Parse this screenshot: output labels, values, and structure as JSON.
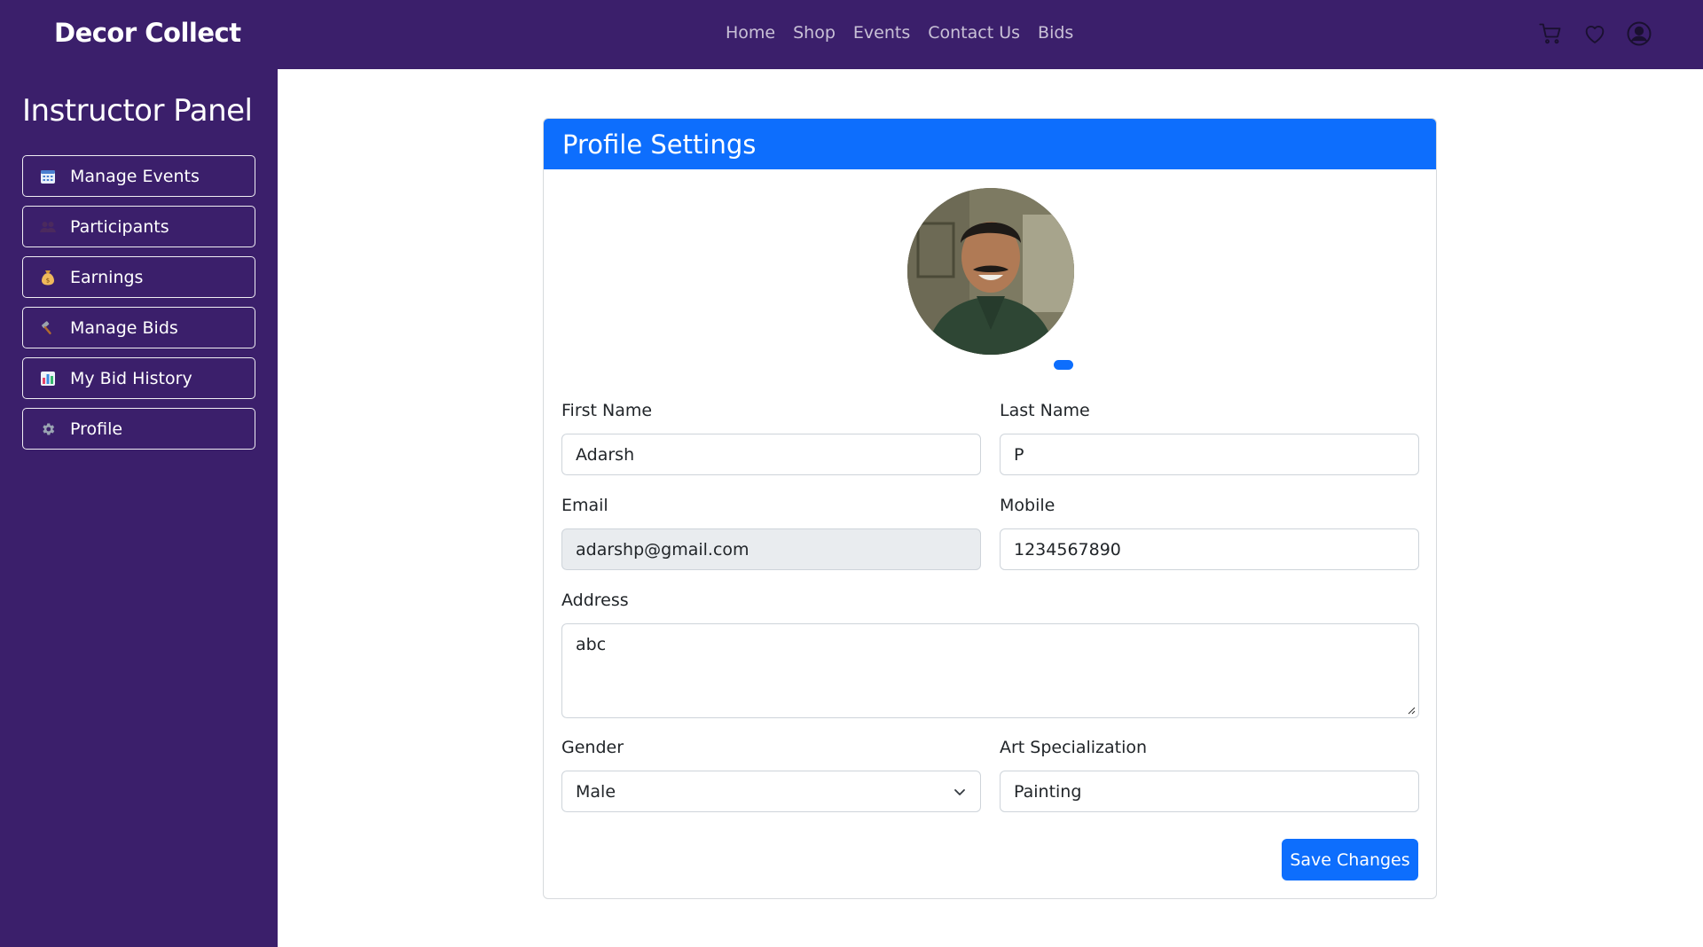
{
  "app": {
    "brand": "Decor Collect"
  },
  "nav": {
    "links": [
      "Home",
      "Shop",
      "Events",
      "Contact Us",
      "Bids"
    ],
    "icons": [
      "cart-icon",
      "heart-icon",
      "user-circle-icon"
    ]
  },
  "sidebar": {
    "title": "Instructor Panel",
    "items": [
      {
        "label": "Manage Events",
        "icon": "calendar-icon"
      },
      {
        "label": "Participants",
        "icon": "people-icon"
      },
      {
        "label": "Earnings",
        "icon": "money-bag-icon"
      },
      {
        "label": "Manage Bids",
        "icon": "hammer-icon"
      },
      {
        "label": "My Bid History",
        "icon": "bar-chart-icon"
      },
      {
        "label": "Profile",
        "icon": "gear-icon"
      }
    ]
  },
  "profile": {
    "header": "Profile Settings",
    "fields": {
      "first_name": {
        "label": "First Name",
        "value": "Adarsh"
      },
      "last_name": {
        "label": "Last Name",
        "value": "P"
      },
      "email": {
        "label": "Email",
        "value": "adarshp@gmail.com"
      },
      "mobile": {
        "label": "Mobile",
        "value": "1234567890"
      },
      "address": {
        "label": "Address",
        "value": "abc"
      },
      "gender": {
        "label": "Gender",
        "value": "Male"
      },
      "art_specialization": {
        "label": "Art Specialization",
        "value": "Painting"
      }
    },
    "save_label": "Save Changes"
  },
  "colors": {
    "navbar": "#3b1f6b",
    "primary": "#0d6efd",
    "disabled_field": "#e9ecef"
  }
}
